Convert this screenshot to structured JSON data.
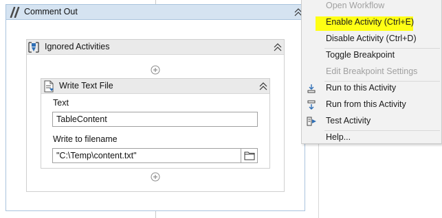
{
  "comment_out": {
    "title": "Comment Out"
  },
  "ignored_activities": {
    "title": "Ignored Activities"
  },
  "write_text_file": {
    "title": "Write Text File",
    "text_label": "Text",
    "text_value": "TableContent",
    "filename_label": "Write to filename",
    "filename_value": "\"C:\\Temp\\content.txt\""
  },
  "context_menu": {
    "items": [
      {
        "label": "Open Workflow",
        "enabled": false,
        "icon": ""
      },
      {
        "label": "Enable Activity (Ctrl+E)",
        "enabled": true,
        "icon": "",
        "highlighted": true
      },
      {
        "label": "Disable Activity (Ctrl+D)",
        "enabled": true,
        "icon": ""
      },
      {
        "label": "Toggle Breakpoint",
        "enabled": true,
        "icon": ""
      },
      {
        "label": "Edit Breakpoint Settings",
        "enabled": false,
        "icon": ""
      },
      {
        "label": "Run to this Activity",
        "enabled": true,
        "icon": "run-to-activity-icon"
      },
      {
        "label": "Run from this Activity",
        "enabled": true,
        "icon": "run-from-activity-icon"
      },
      {
        "label": "Test Activity",
        "enabled": true,
        "icon": "test-activity-icon"
      },
      {
        "label": "Help...",
        "enabled": true,
        "icon": ""
      }
    ]
  },
  "colors": {
    "container_header": "#d5e3f1",
    "container_border": "#a9c3dd",
    "highlight": "#ffff14",
    "menu_background": "#f2f2f2",
    "disabled_text": "#a0a0a0"
  }
}
